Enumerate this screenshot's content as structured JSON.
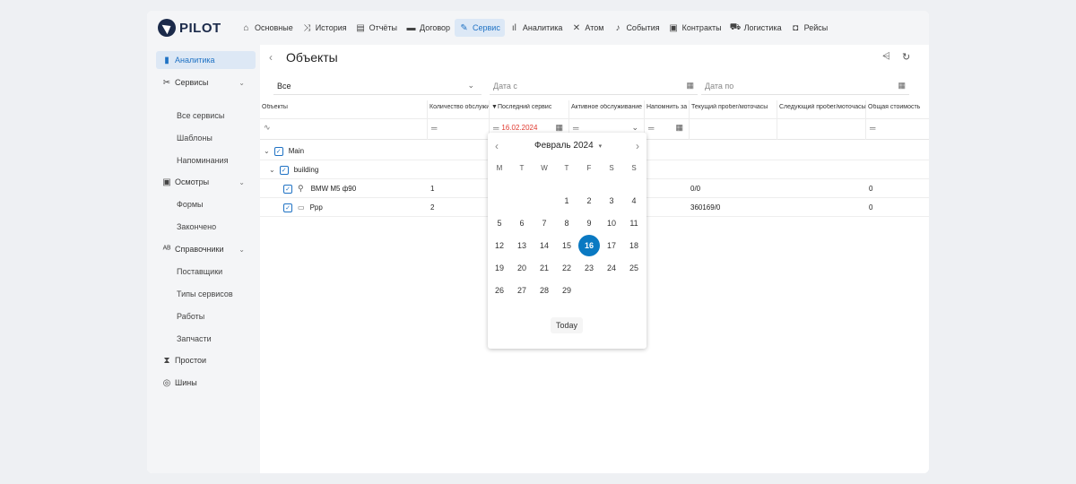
{
  "app": {
    "logo_text": "PILOT"
  },
  "nav": [
    {
      "label": "Основные",
      "icon": "home-icon",
      "glyph": "⌂"
    },
    {
      "label": "История",
      "icon": "history-icon",
      "glyph": "⤨"
    },
    {
      "label": "Отчёты",
      "icon": "report-icon",
      "glyph": "▤"
    },
    {
      "label": "Договор",
      "icon": "contract-icon",
      "glyph": "▬"
    },
    {
      "label": "Сервис",
      "icon": "wrench-icon",
      "glyph": "✎",
      "active": true
    },
    {
      "label": "Аналитика",
      "icon": "analytics-icon",
      "glyph": "ıl"
    },
    {
      "label": "Атом",
      "icon": "atom-icon",
      "glyph": "✕"
    },
    {
      "label": "События",
      "icon": "bell-icon",
      "glyph": "♪"
    },
    {
      "label": "Контракты",
      "icon": "briefcase-icon",
      "glyph": "▣"
    },
    {
      "label": "Логистика",
      "icon": "truck-icon",
      "glyph": "⛟"
    },
    {
      "label": "Рейсы",
      "icon": "bus-icon",
      "glyph": "◘"
    }
  ],
  "sidebar": {
    "analytics": "Аналитика",
    "services": "Сервисы",
    "services_sub": [
      "Все сервисы",
      "Шаблоны",
      "Напоминания"
    ],
    "inspections": "Осмотры",
    "inspections_sub": [
      "Формы",
      "Закончено"
    ],
    "references": "Справочники",
    "references_sub": [
      "Поставщики",
      "Типы сервисов",
      "Работы",
      "Запчасти"
    ],
    "downtime": "Простои",
    "tires": "Шины"
  },
  "main": {
    "back": "‹",
    "title": "Объекты",
    "filter_select": "Все",
    "date_from_placeholder": "Дата с",
    "date_to_placeholder": "Дата по"
  },
  "table": {
    "columns": [
      "Объекты",
      "Количество обслуживаний",
      "Последний сервис",
      "Активное обслуживание",
      "Напомнить за",
      "Текущий пробег/моточасы",
      "Следующий пробег/моточасы",
      "Общая стоимость"
    ],
    "last_service_filter": "16.02.2024",
    "rows": [
      {
        "name": "Main",
        "level": 0,
        "count": "",
        "mileage": "",
        "total": ""
      },
      {
        "name": "building",
        "level": 1,
        "count": "",
        "mileage": "",
        "total": ""
      },
      {
        "name": "BMW M5 ф90",
        "level": 2,
        "icon": "pin-icon",
        "count": "1",
        "mileage": "0/0",
        "total": "0"
      },
      {
        "name": "Ppp",
        "level": 2,
        "icon": "car-icon",
        "count": "2",
        "mileage": "360169/0",
        "total": "0"
      }
    ]
  },
  "calendar": {
    "month_label": "Февраль 2024",
    "weekdays": [
      "M",
      "T",
      "W",
      "T",
      "F",
      "S",
      "S"
    ],
    "first_weekday_index": 3,
    "days_in_month": 29,
    "selected_day": 16,
    "today_label": "Today"
  },
  "colors": {
    "accent": "#1f72c4",
    "selected": "#0a79c2",
    "filter_value": "#e0392f"
  }
}
